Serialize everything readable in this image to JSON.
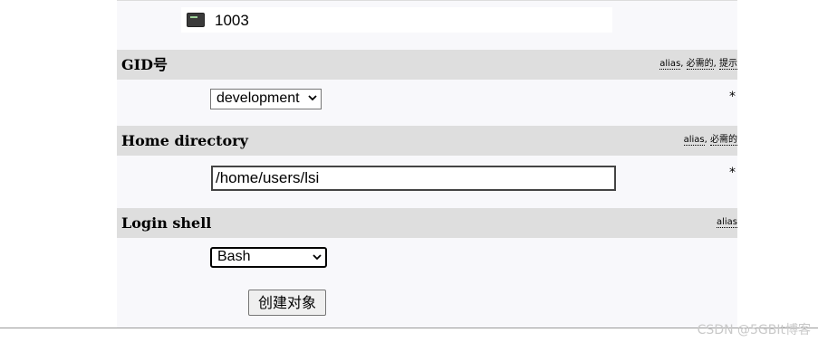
{
  "uid_row": {
    "value": "1003",
    "icon": "terminal-icon"
  },
  "gid": {
    "title": "GID号",
    "flags": [
      "alias",
      "必需的",
      "提示"
    ],
    "select_value": "development",
    "required_mark": "*"
  },
  "home": {
    "title": "Home directory",
    "flags": [
      "alias",
      "必需的"
    ],
    "input_value": "/home/users/lsi",
    "required_mark": "*"
  },
  "shell": {
    "title": "Login shell",
    "flags": [
      "alias"
    ],
    "select_value": "Bash"
  },
  "submit": {
    "label": "创建对象"
  },
  "flag_separator": ", ",
  "watermark": "CSDN @5GBIt博客"
}
